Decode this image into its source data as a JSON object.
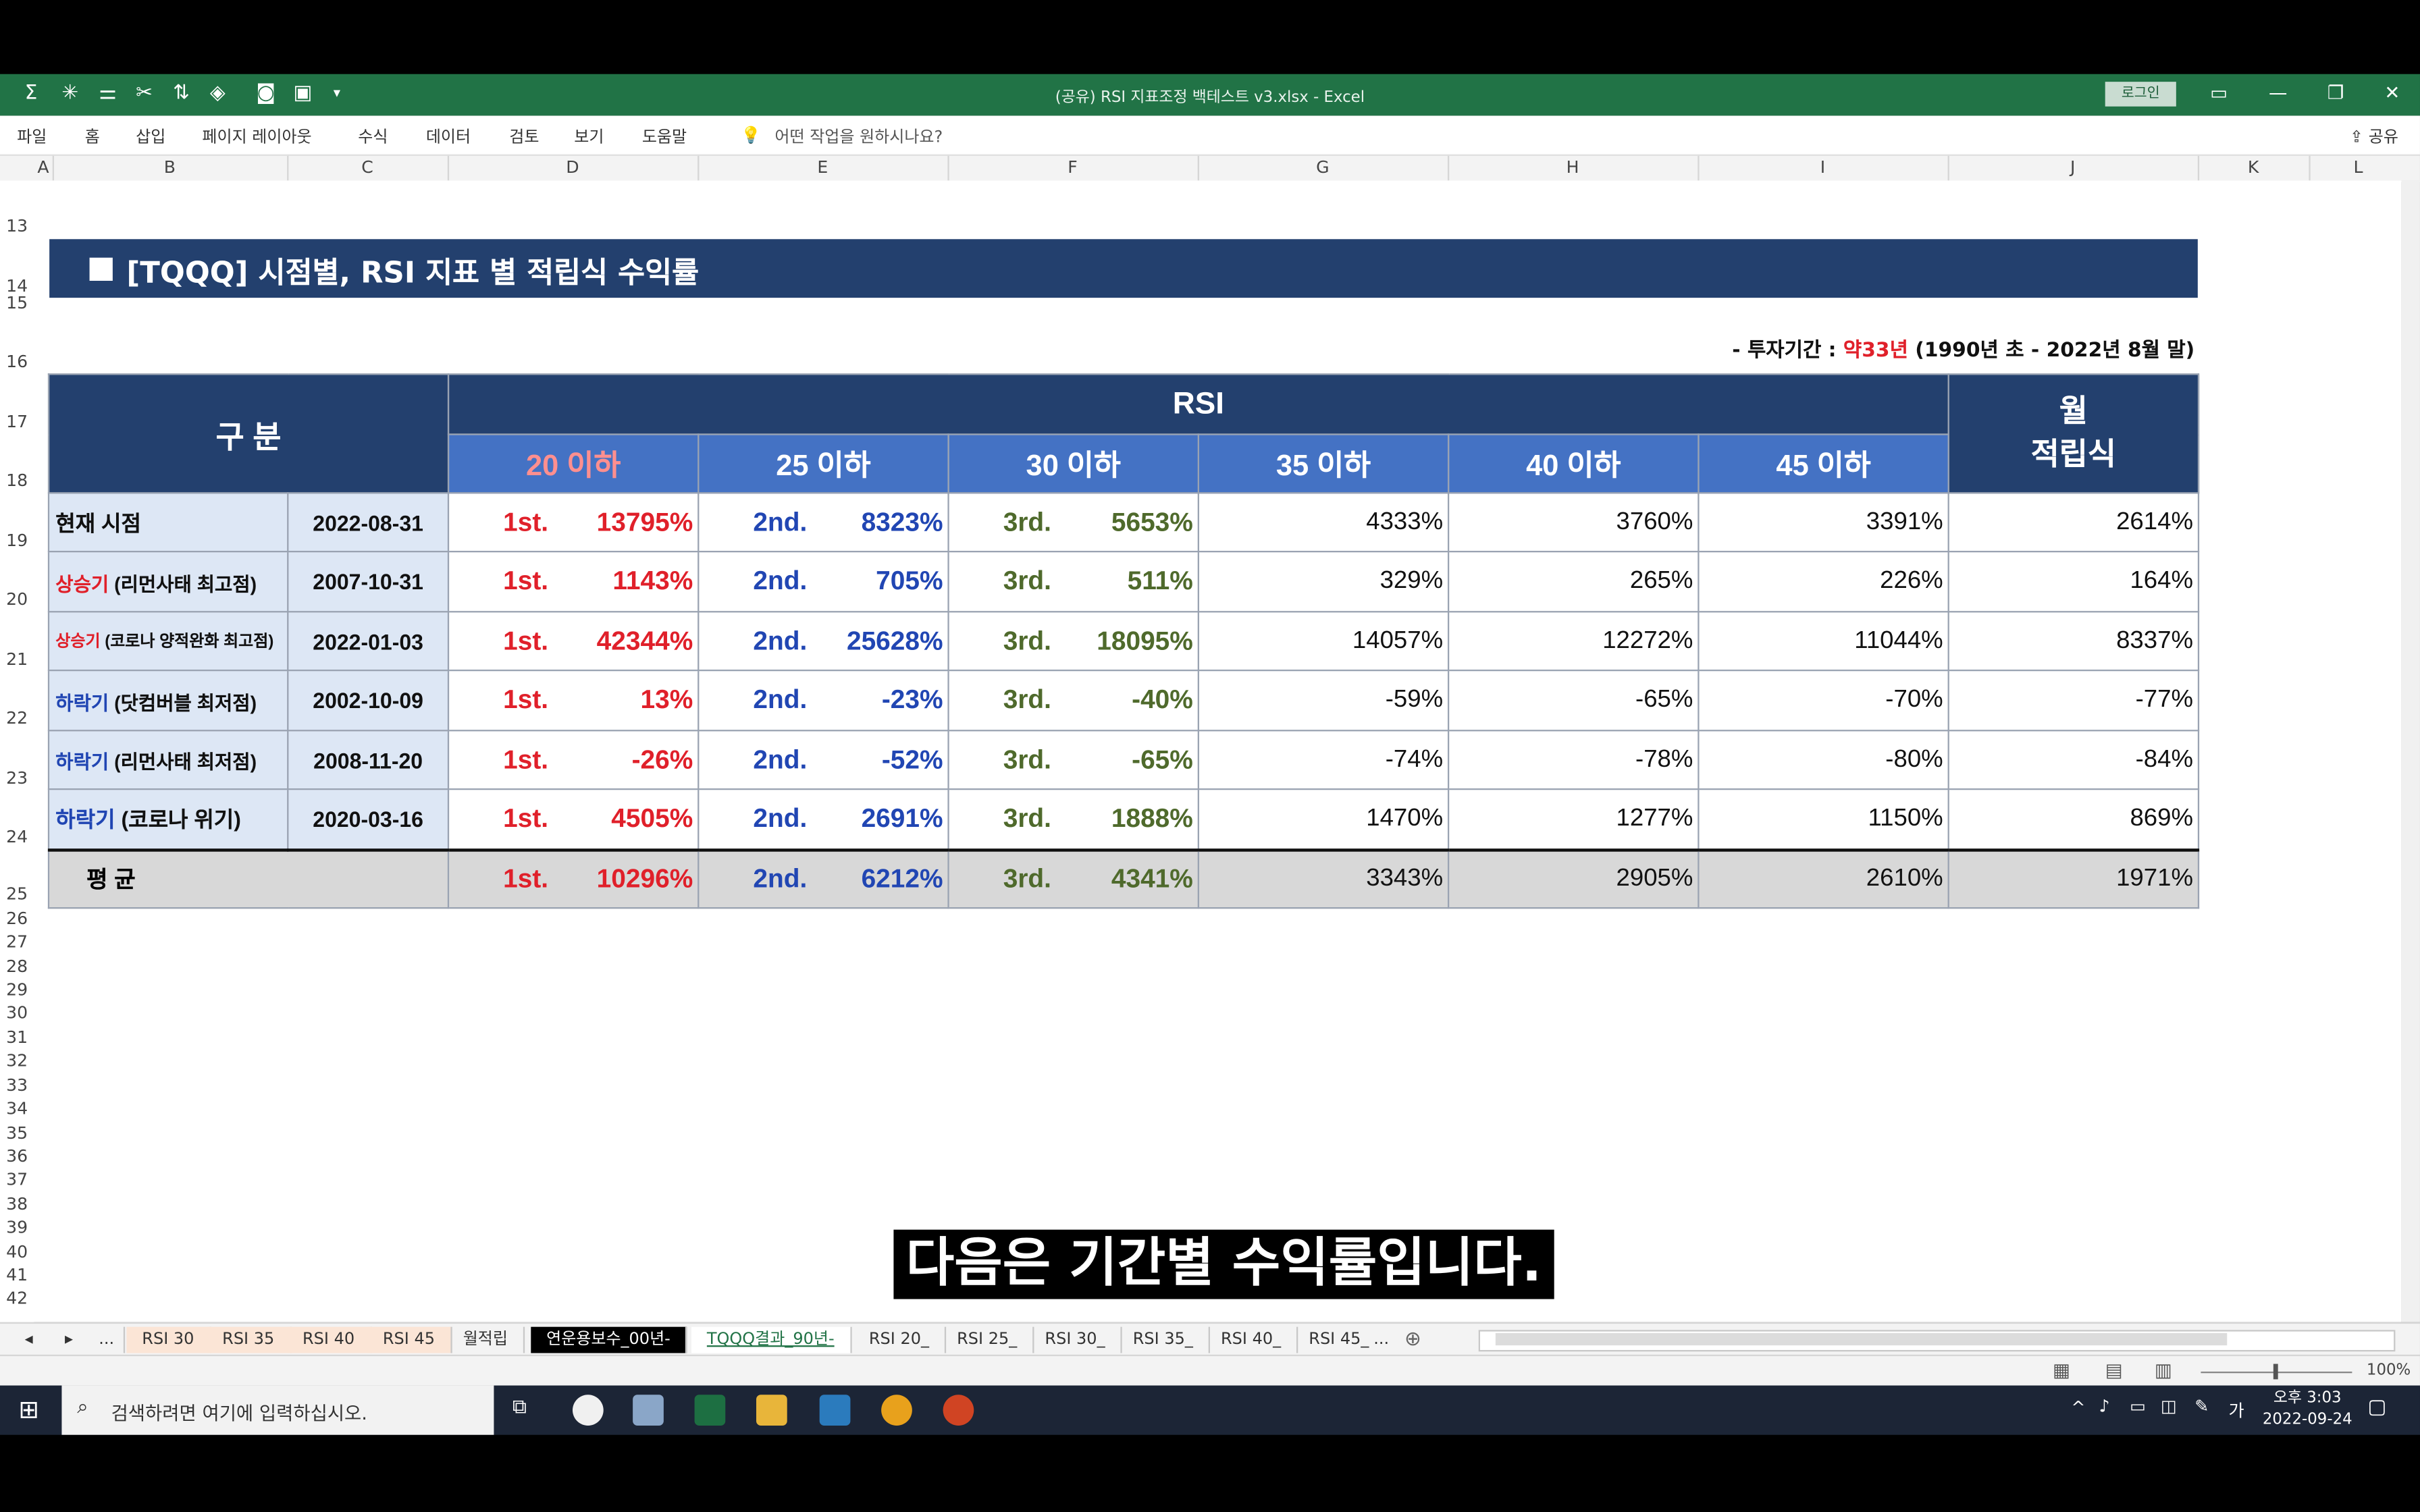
{
  "window": {
    "title": "(공유) RSI 지표조정 백테스트 v3.xlsx  -  Excel",
    "login": "로그인"
  },
  "ribbon": {
    "tabs": [
      "파일",
      "홈",
      "삽입",
      "페이지 레이아웃",
      "수식",
      "데이터",
      "검토",
      "보기",
      "도움말"
    ],
    "tell_me": "어떤 작업을 원하시나요?",
    "share": "공유"
  },
  "columns": [
    "A",
    "B",
    "C",
    "D",
    "E",
    "F",
    "G",
    "H",
    "I",
    "J",
    "K",
    "L"
  ],
  "rows": [
    "13",
    "14",
    "15",
    "16",
    "17",
    "18",
    "19",
    "20",
    "21",
    "22",
    "23",
    "24",
    "25",
    "26",
    "27",
    "28",
    "29",
    "30",
    "31",
    "32",
    "33",
    "34",
    "35",
    "36",
    "37",
    "38",
    "39",
    "40",
    "41",
    "42"
  ],
  "banner": "[TQQQ] 시점별, RSI 지표 별 적립식 수익률",
  "period": {
    "prefix": "- 투자기간 : ",
    "highlight": "약33년",
    "suffix": " (1990년 초 - 2022년 8월 말)"
  },
  "table": {
    "header_gubun": "구 분",
    "header_rsi": "RSI",
    "header_monthly": "월\n적립식",
    "rsi_columns": [
      "20 이하",
      "25 이하",
      "30 이하",
      "35 이하",
      "40 이하",
      "45 이하"
    ],
    "rank_labels": [
      "1st.",
      "2nd.",
      "3rd."
    ],
    "rows": [
      {
        "tag": "",
        "name": "현재 시점",
        "date": "2022-08-31",
        "v": [
          "13795%",
          "8323%",
          "5653%",
          "4333%",
          "3760%",
          "3391%",
          "2614%"
        ]
      },
      {
        "tag": "상승기",
        "name": " (리먼사태 최고점)",
        "date": "2007-10-31",
        "v": [
          "1143%",
          "705%",
          "511%",
          "329%",
          "265%",
          "226%",
          "164%"
        ]
      },
      {
        "tag": "상승기",
        "name": " (코로나 양적완화 최고점)",
        "date": "2022-01-03",
        "v": [
          "42344%",
          "25628%",
          "18095%",
          "14057%",
          "12272%",
          "11044%",
          "8337%"
        ]
      },
      {
        "tag": "하락기",
        "name": " (닷컴버블 최저점)",
        "date": "2002-10-09",
        "v": [
          "13%",
          "-23%",
          "-40%",
          "-59%",
          "-65%",
          "-70%",
          "-77%"
        ]
      },
      {
        "tag": "하락기",
        "name": " (리먼사태 최저점)",
        "date": "2008-11-20",
        "v": [
          "-26%",
          "-52%",
          "-65%",
          "-74%",
          "-78%",
          "-80%",
          "-84%"
        ]
      },
      {
        "tag": "하락기",
        "name": " (코로나 위기)",
        "date": "2020-03-16",
        "v": [
          "4505%",
          "2691%",
          "1888%",
          "1470%",
          "1277%",
          "1150%",
          "869%"
        ]
      }
    ],
    "average": {
      "label": "평  균",
      "v": [
        "10296%",
        "6212%",
        "4341%",
        "3343%",
        "2905%",
        "2610%",
        "1971%"
      ]
    }
  },
  "caption": "다음은 기간별 수익률입니다.",
  "sheet_tabs": [
    "RSI 30",
    "RSI 35",
    "RSI 40",
    "RSI 45",
    "월적립",
    "연운용보수_00년-",
    "TQQQ결과_90년-",
    "RSI 20_",
    "RSI 25_",
    "RSI 30_",
    "RSI 35_",
    "RSI 40_",
    "RSI 45_"
  ],
  "sheet_nav": {
    "prev": "◂",
    "next": "▸",
    "more": "...",
    "add": "⊕"
  },
  "zoom": "100%",
  "taskbar": {
    "search_placeholder": "검색하려면 여기에 입력하십시오.",
    "ime": "가",
    "time": "오후 3:03",
    "date": "2022-09-24"
  },
  "colors": {
    "excel_green": "#217346",
    "banner": "#23406e",
    "subheader": "#4472c4",
    "rank1": "#e0202a",
    "rank2": "#2146b3",
    "rank3": "#4f6a2c"
  }
}
